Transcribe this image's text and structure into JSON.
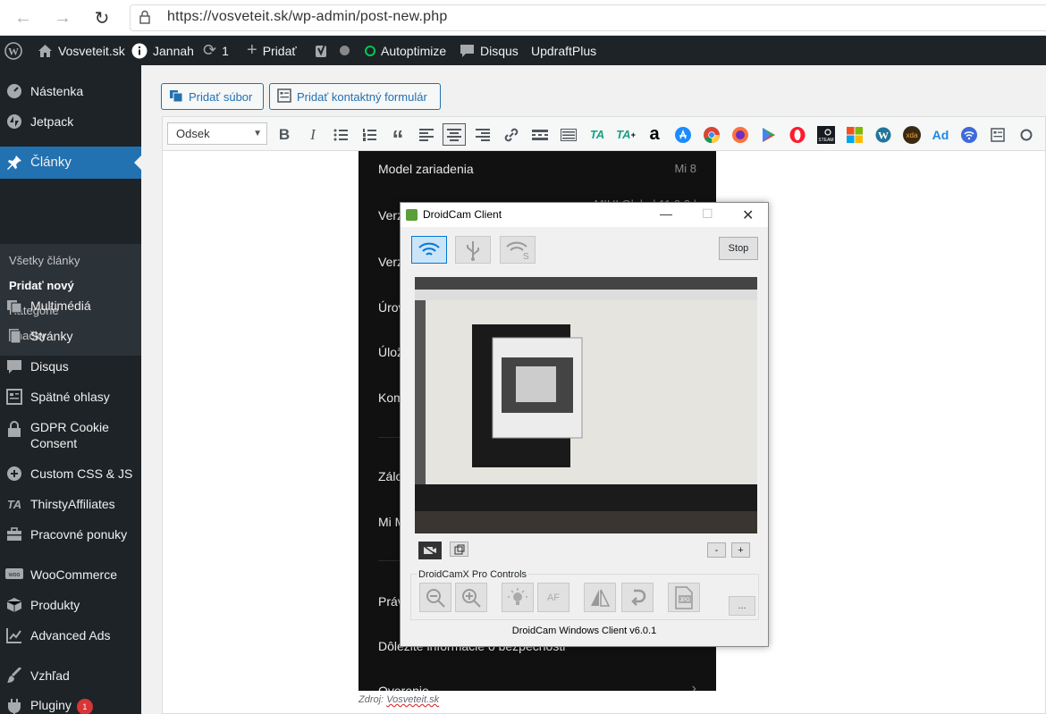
{
  "browser": {
    "url": "https://vosveteit.sk/wp-admin/post-new.php"
  },
  "adminbar": {
    "site_name": "Vosveteit.sk",
    "theme": "Jannah",
    "updates_count": "1",
    "new_label": "Pridať",
    "autoptimize": "Autoptimize",
    "disqus": "Disqus",
    "updraft": "UpdraftPlus"
  },
  "sidebar": {
    "items": [
      {
        "label": "Nástenka",
        "icon": "dashboard-icon"
      },
      {
        "label": "Jetpack",
        "icon": "jetpack-icon"
      },
      {
        "label": "Články",
        "icon": "pin-icon"
      },
      {
        "label": "Multimédiá",
        "icon": "media-icon"
      },
      {
        "label": "Stránky",
        "icon": "pages-icon"
      },
      {
        "label": "Disqus",
        "icon": "comment-icon"
      },
      {
        "label": "Spätné ohlasy",
        "icon": "feedback-icon"
      },
      {
        "label": "GDPR Cookie Consent",
        "icon": "lock-icon"
      },
      {
        "label": "Custom CSS & JS",
        "icon": "plus-circle-icon"
      },
      {
        "label": "ThirstyAffiliates",
        "icon": "ta-icon"
      },
      {
        "label": "Pracovné ponuky",
        "icon": "briefcase-icon"
      },
      {
        "label": "WooCommerce",
        "icon": "woo-icon"
      },
      {
        "label": "Produkty",
        "icon": "box-icon"
      },
      {
        "label": "Advanced Ads",
        "icon": "chart-icon"
      },
      {
        "label": "Vzhľad",
        "icon": "brush-icon"
      },
      {
        "label": "Pluginy",
        "icon": "plugin-icon",
        "badge": "1"
      }
    ],
    "submenu": [
      "Všetky články",
      "Pridať nový",
      "Kategórie",
      "Značky"
    ]
  },
  "editor": {
    "add_file": "Pridať súbor",
    "add_form": "Pridať kontaktný formulár",
    "format": "Odsek"
  },
  "phone": {
    "rows": [
      {
        "label": "Model zariadenia",
        "value": "Mi 8"
      },
      {
        "label": "Verz",
        "value": "MIUI Global 11.0.2 |"
      },
      {
        "label": "Verz",
        "value": ""
      },
      {
        "label": "Úrov",
        "value": ""
      },
      {
        "label": "Úlož",
        "value": ""
      },
      {
        "label": "Kom",
        "value": ""
      },
      {
        "label": "Zálo",
        "value": ""
      },
      {
        "label": "Mi M",
        "value": ""
      },
      {
        "label": "Práv",
        "value": ""
      },
      {
        "label": "Dôležité informácie o bezpečnosti",
        "value": ""
      },
      {
        "label": "Overenie",
        "value": ""
      }
    ],
    "caption_prefix": "Zdroj:",
    "caption_link": "Vosveteit.sk"
  },
  "dialog": {
    "title": "DroidCam Client",
    "stop": "Stop",
    "minus": "-",
    "plus": "+",
    "pro_label": "DroidCamX Pro Controls",
    "af": "AF",
    "more": "...",
    "footer": "DroidCam Windows Client v6.0.1"
  }
}
